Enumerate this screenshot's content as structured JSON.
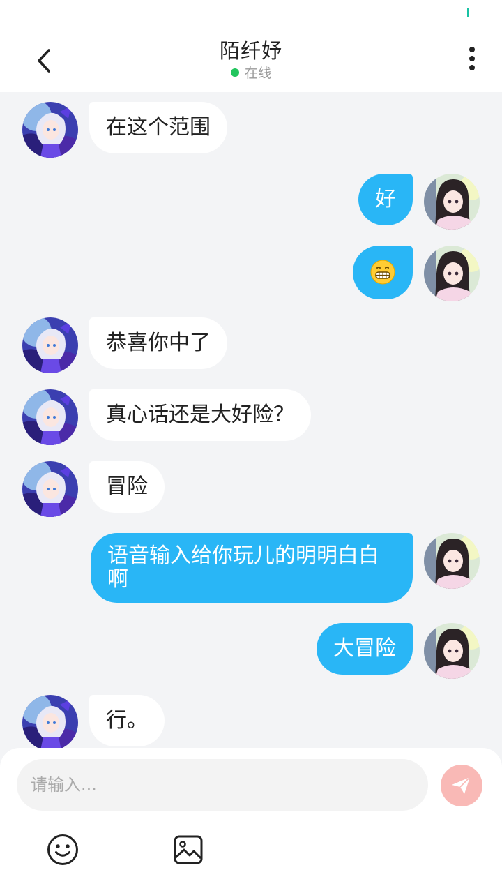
{
  "header": {
    "title": "陌纤妤",
    "status": "在线",
    "status_color": "#22c55e",
    "back_icon": "chevron-left-icon",
    "more_icon": "more-vertical-icon"
  },
  "theme": {
    "accent": "#29b6f6",
    "chat_background": "#f3f4f6",
    "send_button": "#f9b9b6"
  },
  "messages": [
    {
      "side": "left",
      "text": "在这个范围"
    },
    {
      "side": "right",
      "text": "好"
    },
    {
      "side": "right",
      "emoji": "grinning-face-emoji"
    },
    {
      "side": "left",
      "text": "恭喜你中了"
    },
    {
      "side": "left",
      "text": "真心话还是大好险？"
    },
    {
      "side": "left",
      "text": "冒险"
    },
    {
      "side": "right",
      "text": "语音输入给你玩儿的明明白白啊"
    },
    {
      "side": "right",
      "text": "大冒险"
    },
    {
      "side": "left",
      "text": "行。"
    }
  ],
  "composer": {
    "placeholder": "请输入...",
    "send_icon": "send-icon",
    "emoji_icon": "smiley-icon",
    "image_icon": "image-icon"
  }
}
